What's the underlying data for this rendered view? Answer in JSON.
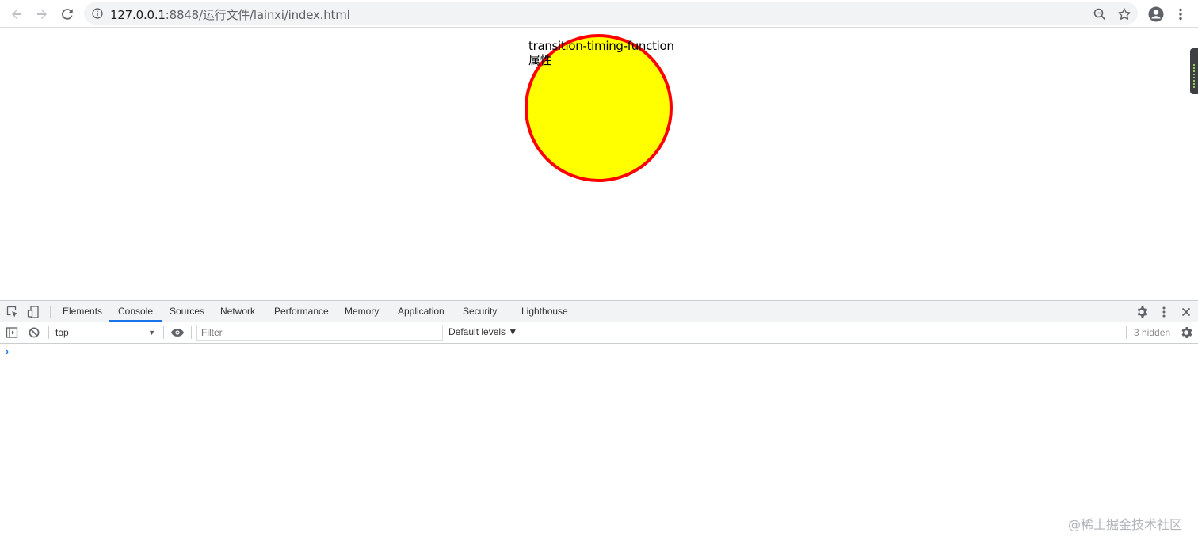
{
  "browser": {
    "url_host": "127.0.0.1",
    "url_rest": ":8848/运行文件/lainxi/index.html",
    "icons": [
      "back-arrow-icon",
      "forward-arrow-icon",
      "reload-icon",
      "info-icon",
      "zoom-icon",
      "star-icon",
      "account-icon",
      "menu-kebab-icon"
    ]
  },
  "page": {
    "ball_text_line1": "transition-timing-function",
    "ball_text_line2": "属性",
    "ball_fill_color": "#ffff00",
    "ball_border_color": "#ff0000"
  },
  "devtools": {
    "tabs": [
      {
        "label": "Elements",
        "active": false
      },
      {
        "label": "Console",
        "active": true
      },
      {
        "label": "Sources",
        "active": false
      },
      {
        "label": "Network",
        "active": false
      },
      {
        "label": "Performance",
        "active": false
      },
      {
        "label": "Memory",
        "active": false
      },
      {
        "label": "Application",
        "active": false
      },
      {
        "label": "Security",
        "active": false
      },
      {
        "label": "Lighthouse",
        "active": false
      }
    ],
    "accent_color": "#1a73e8",
    "toolbar": {
      "context": "top",
      "filter_placeholder": "Filter",
      "levels": "Default levels ▼",
      "hidden": "3 hidden"
    },
    "console_prompt": "›"
  },
  "watermark": "@稀土掘金技术社区"
}
